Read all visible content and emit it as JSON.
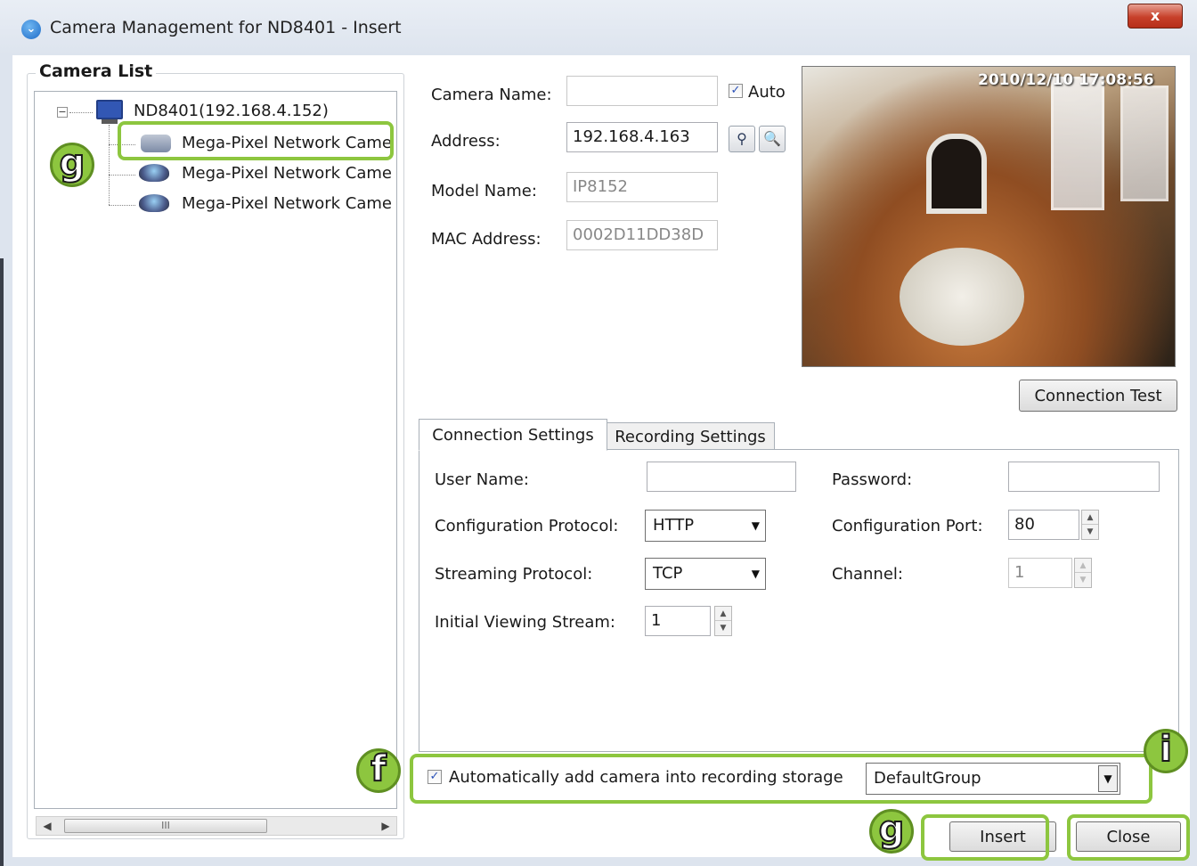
{
  "window": {
    "title": "Camera Management for ND8401 - Insert",
    "close_glyph": "x",
    "app_icon": "chevron-logo-icon"
  },
  "camera_list": {
    "title": "Camera List",
    "root": "ND8401(192.168.4.152)",
    "items": [
      {
        "label": "Mega-Pixel Network Came",
        "icon": "box-camera-icon"
      },
      {
        "label": "Mega-Pixel Network Came",
        "icon": "dome-camera-icon"
      },
      {
        "label": "Mega-Pixel Network Came",
        "icon": "dome-camera-icon"
      }
    ],
    "scroll_thumb_glyph": "III"
  },
  "details": {
    "camera_name_label": "Camera Name:",
    "camera_name_value": "",
    "auto_label": "Auto",
    "auto_checked": true,
    "address_label": "Address:",
    "address_value": "192.168.4.163",
    "model_name_label": "Model Name:",
    "model_name_value": "IP8152",
    "mac_label": "MAC Address:",
    "mac_value": "0002D11DD38D"
  },
  "preview": {
    "timestamp": "2010/12/10  17:08:56"
  },
  "connection_test_label": "Connection Test",
  "tabs": [
    "Connection Settings",
    "Recording Settings"
  ],
  "connection": {
    "user_name_label": "User Name:",
    "user_name_value": "",
    "password_label": "Password:",
    "password_value": "",
    "config_protocol_label": "Configuration Protocol:",
    "config_protocol_value": "HTTP",
    "config_port_label": "Configuration Port:",
    "config_port_value": "80",
    "streaming_protocol_label": "Streaming Protocol:",
    "streaming_protocol_value": "TCP",
    "channel_label": "Channel:",
    "channel_value": "1",
    "initial_stream_label": "Initial Viewing Stream:",
    "initial_stream_value": "1"
  },
  "auto_add": {
    "label": "Automatically add camera into recording storage",
    "checked": true,
    "group_value": "DefaultGroup"
  },
  "buttons": {
    "insert": "Insert",
    "close": "Close"
  },
  "callouts": {
    "g_top": "g",
    "f": "f",
    "i": "i",
    "g_bottom": "g",
    "color": "#8dc63f"
  }
}
